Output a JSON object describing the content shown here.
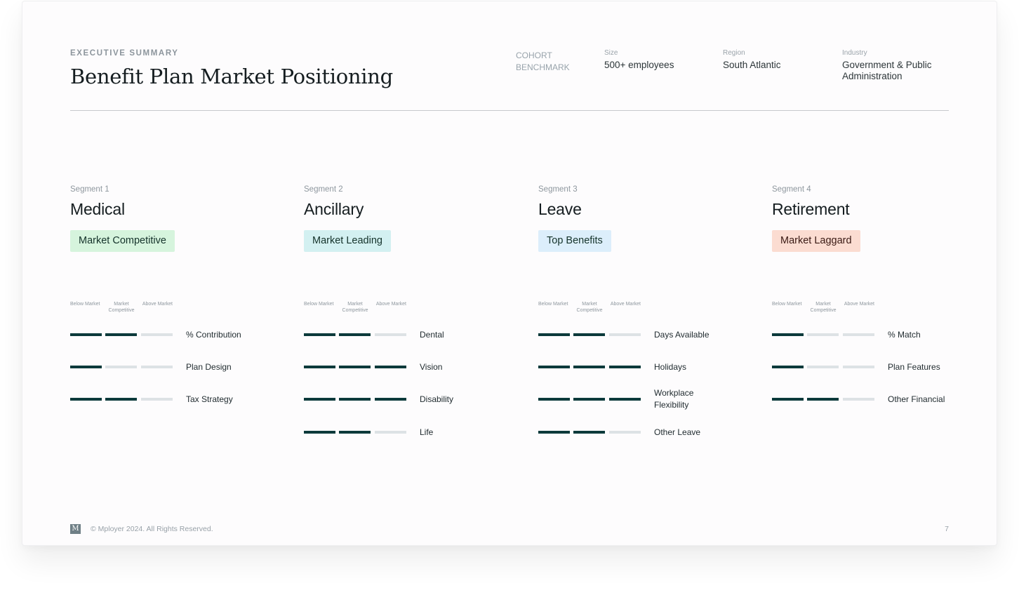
{
  "header": {
    "eyebrow": "EXECUTIVE SUMMARY",
    "title": "Benefit Plan Market Positioning",
    "cohort_label": "COHORT BENCHMARK",
    "size": {
      "label": "Size",
      "value": "500+ employees"
    },
    "region": {
      "label": "Region",
      "value": "South Atlantic"
    },
    "industry": {
      "label": "Industry",
      "value": "Government & Public Administration"
    }
  },
  "scale": {
    "below": "Below Market",
    "competitive": "Market Competitive",
    "above": "Above Market"
  },
  "segments": [
    {
      "label": "Segment 1",
      "name": "Medical",
      "badge": "Market Competitive",
      "badge_bg": "#d6f4dd",
      "badge_fg": "#14322a",
      "rows": [
        {
          "label": "% Contribution",
          "level": 2
        },
        {
          "label": "Plan Design",
          "level": 1
        },
        {
          "label": "Tax Strategy",
          "level": 2
        }
      ]
    },
    {
      "label": "Segment 2",
      "name": "Ancillary",
      "badge": "Market Leading",
      "badge_bg": "#d3f0f1",
      "badge_fg": "#14322a",
      "rows": [
        {
          "label": "Dental",
          "level": 2
        },
        {
          "label": "Vision",
          "level": 3
        },
        {
          "label": "Disability",
          "level": 3
        },
        {
          "label": "Life",
          "level": 2
        }
      ]
    },
    {
      "label": "Segment 3",
      "name": "Leave",
      "badge": "Top Benefits",
      "badge_bg": "#dceefb",
      "badge_fg": "#14322a",
      "rows": [
        {
          "label": "Days Available",
          "level": 2
        },
        {
          "label": "Holidays",
          "level": 3
        },
        {
          "label": "Workplace Flexibility",
          "level": 3
        },
        {
          "label": "Other Leave",
          "level": 2
        }
      ]
    },
    {
      "label": "Segment 4",
      "name": "Retirement",
      "badge": "Market Laggard",
      "badge_bg": "#fbdcd1",
      "badge_fg": "#3a1a14",
      "rows": [
        {
          "label": "% Match",
          "level": 1
        },
        {
          "label": "Plan Features",
          "level": 1
        },
        {
          "label": "Other Financial",
          "level": 2
        }
      ]
    }
  ],
  "footer": {
    "logo": "M",
    "copyright": "© Mployer 2024. All Rights Reserved.",
    "page": "7"
  }
}
